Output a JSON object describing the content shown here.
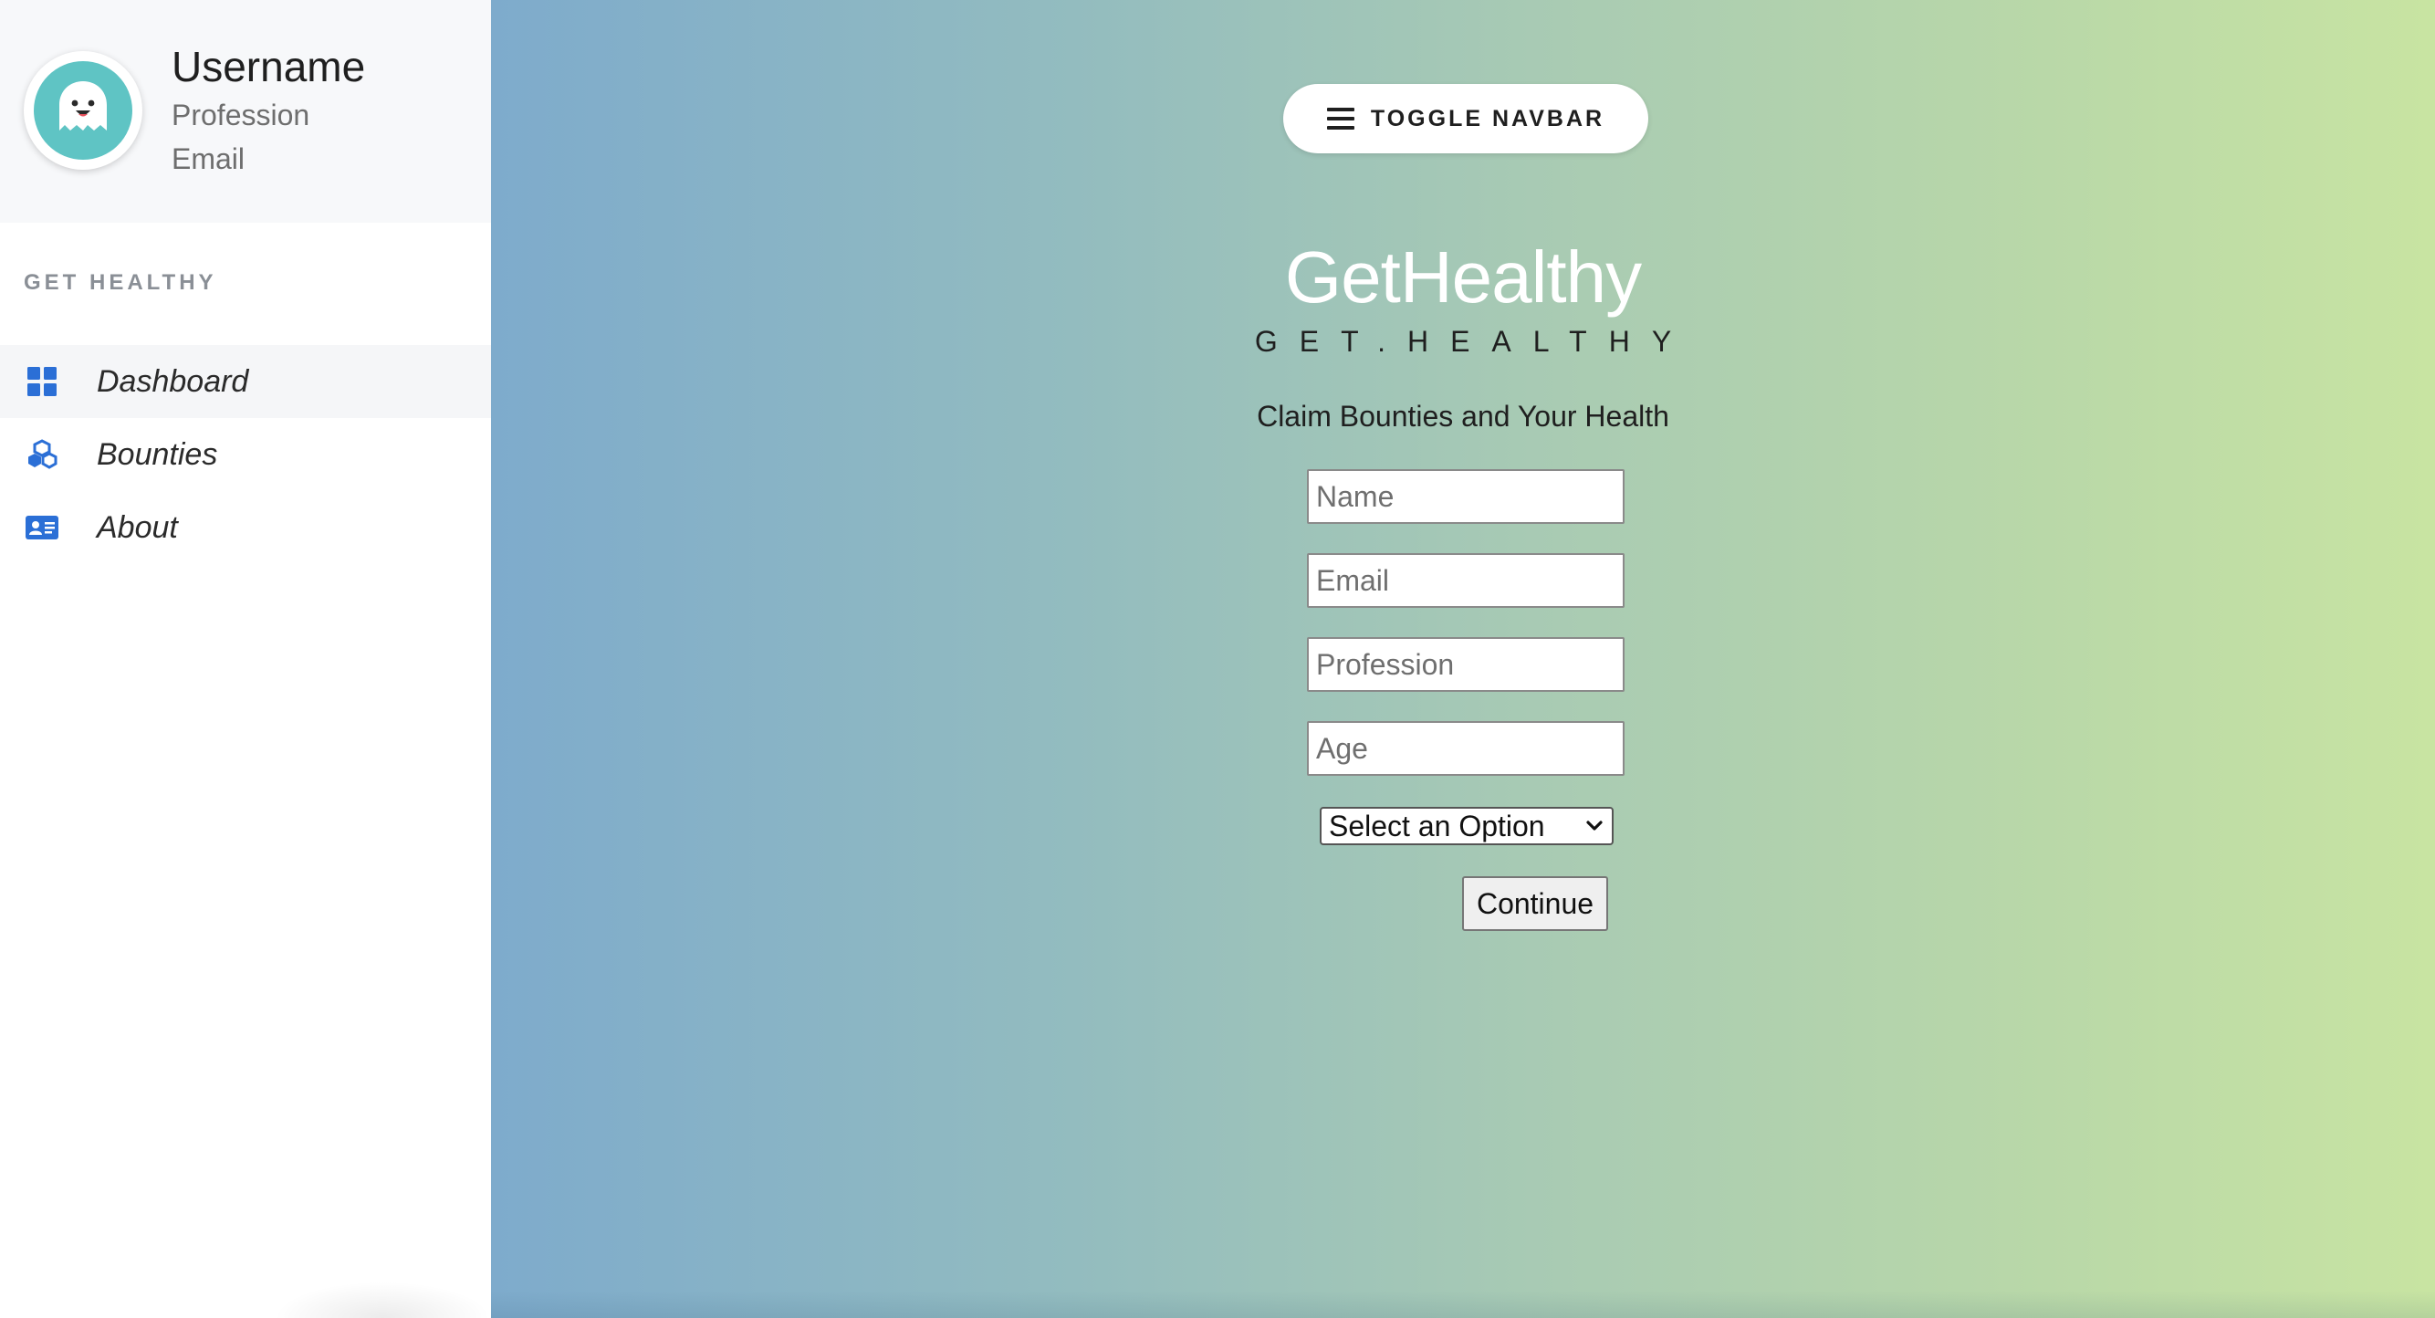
{
  "sidebar": {
    "profile": {
      "avatar_icon": "ghost-avatar-icon",
      "username": "Username",
      "profession": "Profession",
      "email": "Email"
    },
    "section_title": "GET HEALTHY",
    "items": [
      {
        "label": "Dashboard",
        "icon": "dashboard-grid-icon",
        "active": true
      },
      {
        "label": "Bounties",
        "icon": "cubes-icon",
        "active": false
      },
      {
        "label": "About",
        "icon": "id-card-icon",
        "active": false
      }
    ]
  },
  "main": {
    "toggle_button": {
      "label": "TOGGLE NAVBAR",
      "icon": "hamburger-icon"
    },
    "brand_title": "GetHealthy",
    "tagline": "GET.HEALTHY",
    "subtitle": "Claim Bounties and Your Health",
    "form": {
      "name_placeholder": "Name",
      "email_placeholder": "Email",
      "profession_placeholder": "Profession",
      "age_placeholder": "Age",
      "select_value": "Select an Option",
      "continue_label": "Continue"
    }
  },
  "colors": {
    "accent_blue": "#2b6fd6",
    "avatar_teal": "#5fc4c4",
    "gradient_start": "#7eabcc",
    "gradient_end": "#c8e4a2"
  }
}
